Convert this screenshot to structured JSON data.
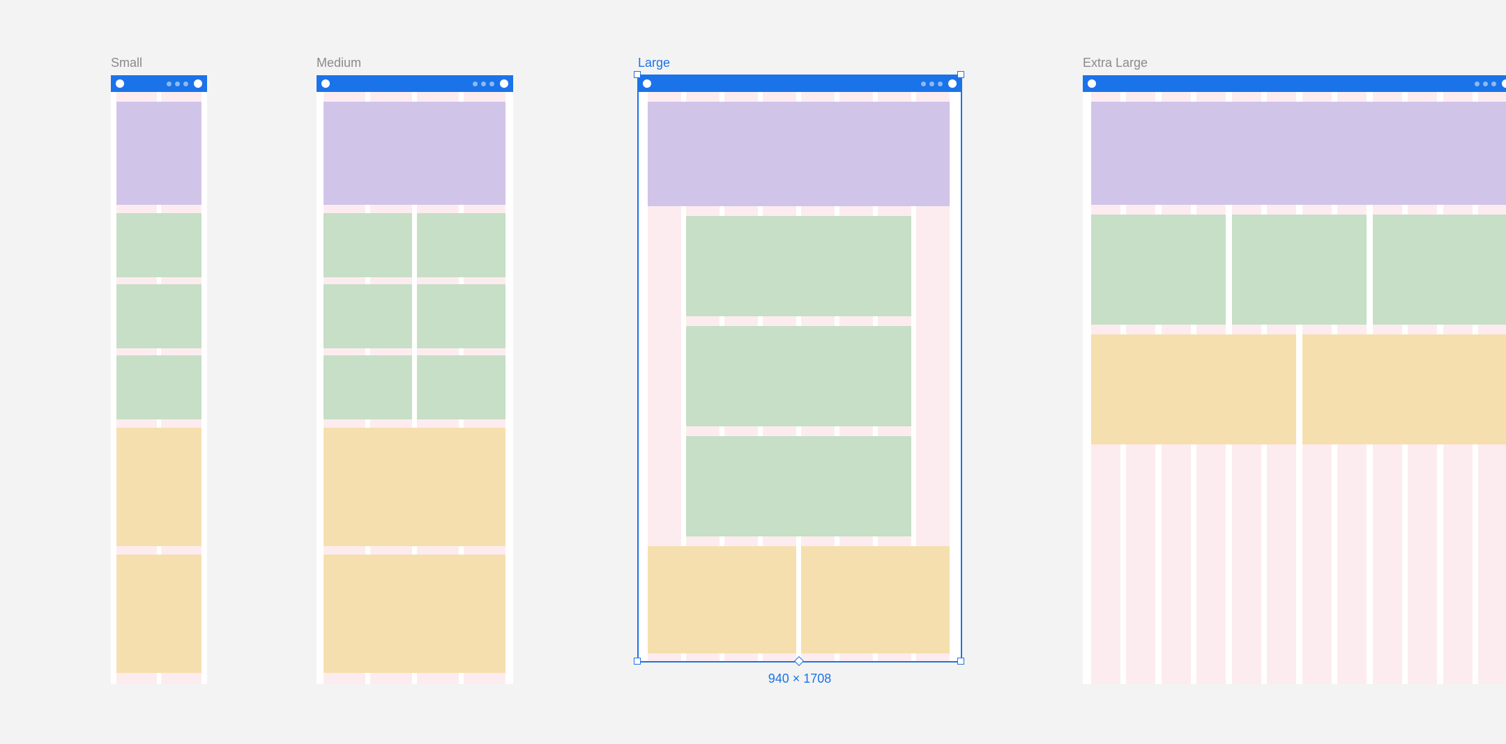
{
  "breakpoints": [
    {
      "key": "small",
      "label": "Small"
    },
    {
      "key": "medium",
      "label": "Medium"
    },
    {
      "key": "large",
      "label": "Large"
    },
    {
      "key": "xlarge",
      "label": "Extra Large"
    }
  ],
  "selection": {
    "frame": "large",
    "dimensions_text": "940 × 1708"
  },
  "colors": {
    "accent": "#1a73e8",
    "grid_column": "#fdecef",
    "block_purple": "#d1c4e9",
    "block_green": "#c6dfc6",
    "block_orange": "#f6dfae",
    "canvas_bg": "#f3f3f3",
    "frame_bg": "#ffffff",
    "label_muted": "#8a8a8a"
  }
}
